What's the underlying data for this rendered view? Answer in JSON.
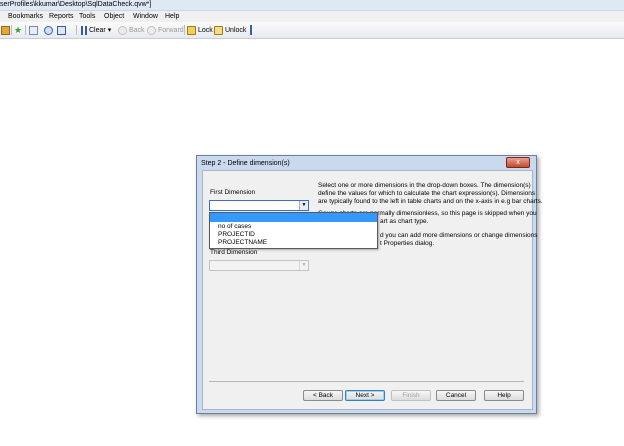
{
  "window": {
    "title": "serProfiles\\kkumar\\Desktop\\SqlDataCheck.qvw*]"
  },
  "menu": {
    "items": [
      "Bookmarks",
      "Reports",
      "Tools",
      "Object",
      "Window",
      "Help"
    ]
  },
  "toolbar": {
    "clear_label": "Clear",
    "clear_dropdown": "▾",
    "back_label": "Back",
    "forward_label": "Forward",
    "lock_label": "Lock",
    "unlock_label": "Unlock"
  },
  "dialog": {
    "title": "Step 2 - Define dimension(s)",
    "close_glyph": "x",
    "first_dimension_label": "First Dimension",
    "third_dimension_label": "Third Dimension",
    "first_dimension_value": "",
    "dropdown_options": [
      "",
      "no of cases",
      "PROJECTID",
      "PROJECTNAME"
    ],
    "help_lines": [
      "Select one or more dimensions in the drop-down boxes. The dimension(s)",
      "define the values for which to calculate the chart expression(s). Dimensions",
      "are typically found to the left in table charts and on the x-axis in e.g bar charts."
    ],
    "help_line_4_visible": "Gauge charts are normally dimensionless, so this page is skipped when you",
    "help_line_5_visible": "art as chart type.",
    "help_line_6_visible": "d you can add more dimensions or change dimensions",
    "help_line_7_visible": "t Properties dialog.",
    "buttons": {
      "back": "< Back",
      "next": "Next >",
      "finish": "Finish",
      "cancel": "Cancel",
      "help": "Help"
    }
  },
  "colors": {
    "selection": "#3399ff",
    "dialog_frame": "#c9d9ee",
    "close_button": "#c44a2f"
  }
}
